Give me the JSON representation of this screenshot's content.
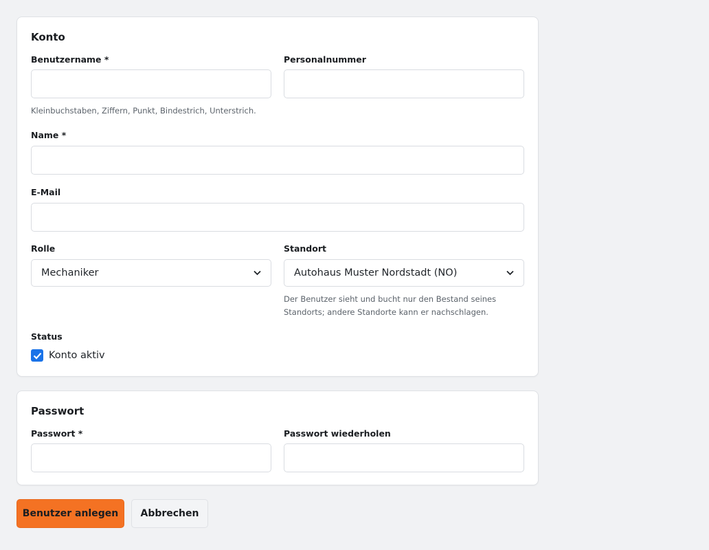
{
  "konto": {
    "title": "Konto",
    "username": {
      "label": "Benutzername *",
      "value": "",
      "help": "Kleinbuchstaben, Ziffern, Punkt, Bindestrich, Unterstrich."
    },
    "personnel_number": {
      "label": "Personalnummer",
      "value": ""
    },
    "name": {
      "label": "Name *",
      "value": ""
    },
    "email": {
      "label": "E-Mail",
      "value": ""
    },
    "role": {
      "label": "Rolle",
      "selected": "Mechaniker"
    },
    "location": {
      "label": "Standort",
      "selected": "Autohaus Muster Nordstadt (NO)",
      "help_line1": "Der Benutzer sieht und bucht nur den Bestand seines",
      "help_line2": "Standorts; andere Standorte kann er nachschlagen."
    },
    "status": {
      "label": "Status",
      "checkbox_label": "Konto aktiv",
      "checked": true
    }
  },
  "passwort": {
    "title": "Passwort",
    "password": {
      "label": "Passwort *",
      "value": ""
    },
    "password_repeat": {
      "label": "Passwort wiederholen",
      "value": ""
    }
  },
  "actions": {
    "primary_label": "Benutzer anlegen",
    "secondary_label": "Abbrechen"
  },
  "colors": {
    "accent": "#f47223",
    "checkbox": "#1a73e8",
    "background": "#f1f2f4"
  },
  "icons": {
    "select_chevron": "chevron-down-icon",
    "checkbox_check": "check-icon"
  }
}
